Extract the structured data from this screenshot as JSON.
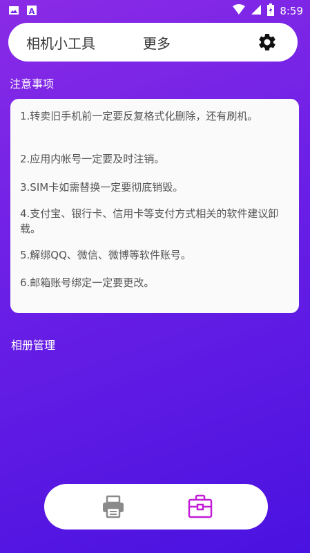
{
  "status_bar": {
    "time": "8:59",
    "icons": [
      "image-icon",
      "a-letter-icon",
      "wifi-icon",
      "signal-icon",
      "battery-icon"
    ],
    "a_label": "A"
  },
  "header": {
    "title": "相机小工具",
    "more": "更多",
    "settings_icon": "gear-icon"
  },
  "notice": {
    "section_title": "注意事项",
    "items": [
      "1.转卖旧手机前一定要反复格式化删除，还有刷机。",
      "2.应用内帐号一定要及时注销。",
      "3.SIM卡如需替换一定要彻底销毁。",
      "4.支付宝、银行卡、信用卡等支付方式相关的软件建议卸载。",
      "5.解绑QQ、微信、微博等软件账号。",
      "6.邮箱账号绑定一定要更改。"
    ]
  },
  "album": {
    "section_title": "相册管理"
  },
  "bottom_nav": {
    "tabs": [
      {
        "icon": "printer-icon",
        "active": false
      },
      {
        "icon": "toolbox-icon",
        "active": true
      }
    ],
    "active_color": "#c21bd6",
    "inactive_color": "#8a8a8a"
  },
  "colors": {
    "background_start": "#8a2be6",
    "background_end": "#4a12e0",
    "card": "#fafafa"
  }
}
